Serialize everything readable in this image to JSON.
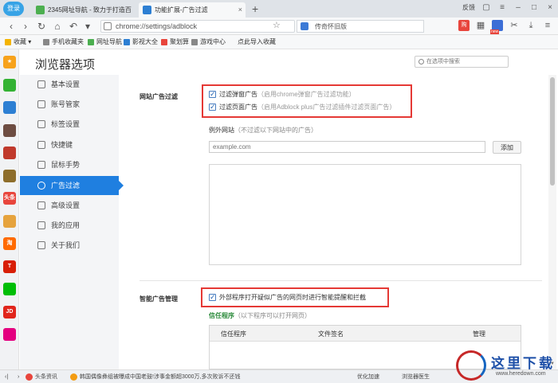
{
  "tabbar": {
    "login": "登录",
    "tabs": [
      {
        "title": "2345网址导航 - 致力于打造百"
      },
      {
        "title": "功能扩展-广告过滤"
      }
    ],
    "new_tab": "+",
    "feedback": "反馈"
  },
  "navbar": {
    "url": "chrome://settings/adblock",
    "search_text": "传奇怀旧版"
  },
  "bookmarks": [
    {
      "label": "收藏 ▾",
      "color": "#f4b400"
    },
    {
      "label": "手机收藏夹",
      "color": "#888888"
    },
    {
      "label": "网址导航",
      "color": "#4caf50"
    },
    {
      "label": "影视大全",
      "color": "#2d7fd3"
    },
    {
      "label": "聚划算",
      "color": "#e8453c"
    },
    {
      "label": "游戏中心",
      "color": "#888888"
    },
    {
      "label": "点此导入收藏",
      "color": "#888888"
    }
  ],
  "apps": [
    {
      "name": "favorite-app-icon",
      "label": "★",
      "color": "#f7a21b"
    },
    {
      "name": "wechat-app-icon",
      "label": "",
      "color": "#34b233"
    },
    {
      "name": "doc-app-icon",
      "label": "",
      "color": "#2d7fd3"
    },
    {
      "name": "game1-app-icon",
      "label": "",
      "color": "#6d4c41"
    },
    {
      "name": "game2-app-icon",
      "label": "",
      "color": "#c0392b"
    },
    {
      "name": "game3-app-icon",
      "label": "",
      "color": "#8e6d2a"
    },
    {
      "name": "toutiao-app-icon",
      "label": "头条",
      "color": "#e8453c"
    },
    {
      "name": "weibo-app-icon",
      "label": "",
      "color": "#e6a33d"
    },
    {
      "name": "taobao-app-icon",
      "label": "淘",
      "color": "#ff6a00"
    },
    {
      "name": "tmall-app-icon",
      "label": "T",
      "color": "#d81e06"
    },
    {
      "name": "iqiyi-app-icon",
      "label": "",
      "color": "#00be06"
    },
    {
      "name": "jd-app-icon",
      "label": "JD",
      "color": "#e1251b"
    },
    {
      "name": "vip-app-icon",
      "label": "",
      "color": "#e4007f"
    }
  ],
  "settings": {
    "title": "浏览器选项",
    "search_placeholder": "在选项中搜索",
    "sidebar": [
      {
        "label": "基本设置"
      },
      {
        "label": "账号管家"
      },
      {
        "label": "标签设置"
      },
      {
        "label": "快捷键"
      },
      {
        "label": "鼠标手势"
      },
      {
        "label": "广告过滤"
      },
      {
        "label": "高级设置"
      },
      {
        "label": "我的应用"
      },
      {
        "label": "关于我们"
      }
    ]
  },
  "adblock": {
    "section_title": "网站广告过滤",
    "popup_label": "过滤弹窗广告",
    "popup_hint": "（启用chrome弹窗广告过滤功能）",
    "page_label": "过滤页面广告",
    "page_hint": "（启用Adblock plus广告过滤插件过滤页面广告）",
    "exception_title": "例外网站",
    "exception_hint": "（不过滤以下网站中的广告）",
    "exception_placeholder": "example.com",
    "add_label": "添加"
  },
  "smart": {
    "section_title": "智能广告管理",
    "option_label": "外部程序打开疑似广告的网页时进行智能提醒和拦截",
    "trusted_title": "信任程序",
    "trusted_hint": "（以下程序可以打开网页）",
    "columns": [
      "信任程序",
      "文件签名",
      "管理"
    ]
  },
  "statusbar": {
    "news": "头条资讯",
    "headline": "韩国偶像彝组被曝成中国老鼓!涉事金额超3000万,多次败诉不还钱",
    "optimize": "优化加速",
    "doctor": "浏览器医生"
  },
  "watermark": {
    "text": "这里下载",
    "url": "www.heredown.com"
  }
}
